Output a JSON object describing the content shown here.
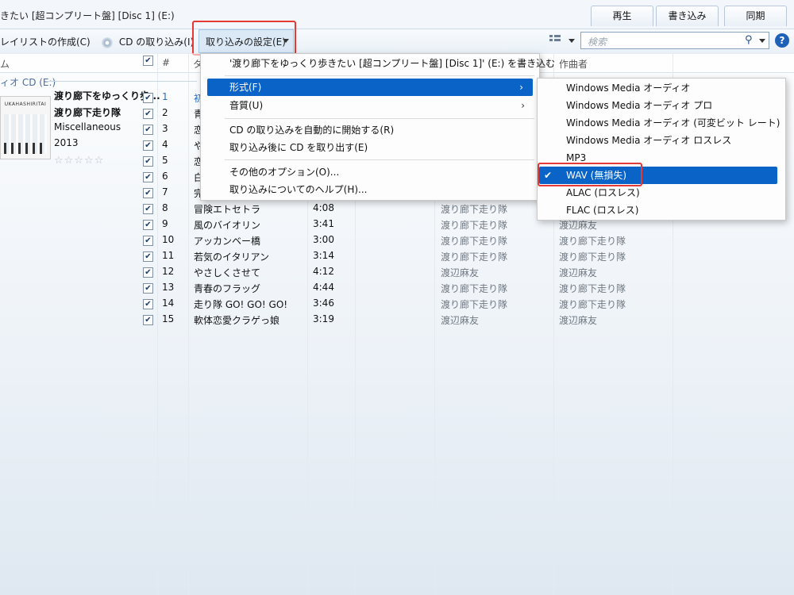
{
  "window": {
    "title": "きたい [超コンプリート盤] [Disc 1] (E:)"
  },
  "top_tabs": [
    "再生",
    "書き込み",
    "同期"
  ],
  "toolbar": {
    "create_playlist": "レイリストの作成(C)",
    "rip_cd": "CD の取り込み(I)",
    "rip_settings": "取り込みの設定(E)",
    "search_placeholder": "検索",
    "help": "?"
  },
  "columns": {
    "col1": "ム",
    "num": "#",
    "title": "タ",
    "composer": "作曲者"
  },
  "group_label": "ィオ CD (E:)",
  "album": {
    "cover_text": "UKAHASHIRITAI",
    "title": "渡り廊下をゆっくり歩...",
    "artist": "渡り廊下走り隊",
    "genre": "Miscellaneous",
    "year": "2013",
    "rating_stars": "☆☆☆☆☆"
  },
  "tracks": [
    {
      "num": "1",
      "title": "初",
      "len": "",
      "artist": "",
      "composer": ""
    },
    {
      "num": "2",
      "title": "青",
      "len": "",
      "artist": "",
      "composer": ""
    },
    {
      "num": "3",
      "title": "恋",
      "len": "",
      "artist": "",
      "composer": ""
    },
    {
      "num": "4",
      "title": "や",
      "len": "",
      "artist": "",
      "composer": ""
    },
    {
      "num": "5",
      "title": "恋",
      "len": "",
      "artist": "",
      "composer": ""
    },
    {
      "num": "6",
      "title": "白",
      "len": "",
      "artist": "",
      "composer": ""
    },
    {
      "num": "7",
      "title": "完",
      "len": "",
      "artist": "",
      "composer": ""
    },
    {
      "num": "8",
      "title": "冒険エトセトラ",
      "len": "4:08",
      "artist": "渡り廊下走り隊",
      "composer": ""
    },
    {
      "num": "9",
      "title": "風のバイオリン",
      "len": "3:41",
      "artist": "渡り廊下走り隊",
      "composer": "渡辺麻友"
    },
    {
      "num": "10",
      "title": "アッカンベー橋",
      "len": "3:00",
      "artist": "渡り廊下走り隊",
      "composer": "渡り廊下走り隊"
    },
    {
      "num": "11",
      "title": "若気のイタリアン",
      "len": "3:14",
      "artist": "渡り廊下走り隊",
      "composer": "渡り廊下走り隊"
    },
    {
      "num": "12",
      "title": "やさしくさせて",
      "len": "4:12",
      "artist": "渡辺麻友",
      "composer": "渡辺麻友"
    },
    {
      "num": "13",
      "title": "青春のフラッグ",
      "len": "4:44",
      "artist": "渡り廊下走り隊",
      "composer": "渡り廊下走り隊"
    },
    {
      "num": "14",
      "title": "走り隊 GO! GO! GO!",
      "len": "3:46",
      "artist": "渡り廊下走り隊",
      "composer": "渡り廊下走り隊"
    },
    {
      "num": "15",
      "title": "軟体恋愛クラゲっ娘",
      "len": "3:19",
      "artist": "渡辺麻友",
      "composer": "渡辺麻友"
    }
  ],
  "rip_menu": {
    "items": [
      "'渡り廊下をゆっくり歩きたい [超コンプリート盤] [Disc 1]' (E:) を書き込む",
      "形式(F)",
      "音質(U)",
      "CD の取り込みを自動的に開始する(R)",
      "取り込み後に CD を取り出す(E)",
      "その他のオプション(O)...",
      "取り込みについてのヘルプ(H)..."
    ]
  },
  "format_menu": {
    "items": [
      "Windows Media オーディオ",
      "Windows Media オーディオ プロ",
      "Windows Media オーディオ (可変ビット レート)",
      "Windows Media オーディオ ロスレス",
      "MP3",
      "WAV (無損失)",
      "ALAC (ロスレス)",
      "FLAC (ロスレス)"
    ],
    "selected_index": 5,
    "check_mark": "✔"
  },
  "colors": {
    "highlight": "#0a64c8",
    "annotation": "#e53935"
  }
}
